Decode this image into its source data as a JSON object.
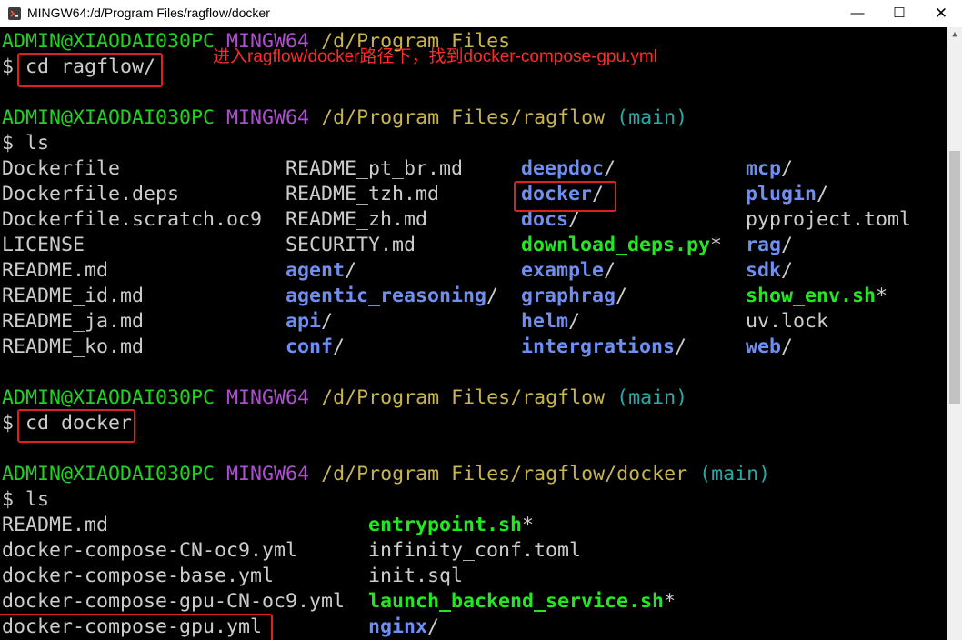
{
  "window": {
    "title": "MINGW64:/d/Program Files/ragflow/docker",
    "minimize": "—",
    "maximize": "☐",
    "close": "✕"
  },
  "annotation": "进入ragflow/docker路径下，找到docker-compose-gpu.yml",
  "colors": {
    "prompt_user": "#1fd41f",
    "mingw": "#b04cd4",
    "path": "#c8b44a",
    "branch": "#2aa8a8",
    "dir": "#6f8ff0",
    "exec": "#22e822",
    "highlight": "#e02020"
  },
  "prompts": [
    {
      "user": "ADMIN@XIAODAI030PC",
      "sys": "MINGW64",
      "path": "/d/Program Files",
      "branch": ""
    },
    {
      "user": "ADMIN@XIAODAI030PC",
      "sys": "MINGW64",
      "path": "/d/Program Files/ragflow",
      "branch": "(main)"
    },
    {
      "user": "ADMIN@XIAODAI030PC",
      "sys": "MINGW64",
      "path": "/d/Program Files/ragflow",
      "branch": "(main)"
    },
    {
      "user": "ADMIN@XIAODAI030PC",
      "sys": "MINGW64",
      "path": "/d/Program Files/ragflow/docker",
      "branch": "(main)"
    }
  ],
  "commands": [
    {
      "ps": "$ ",
      "cmd": "cd ragflow/"
    },
    {
      "ps": "$ ",
      "cmd": "ls"
    },
    {
      "ps": "$ ",
      "cmd": "cd docker"
    },
    {
      "ps": "$ ",
      "cmd": "ls"
    }
  ],
  "ls1": {
    "col1": [
      {
        "name": "Dockerfile",
        "suffix": ""
      },
      {
        "name": "Dockerfile.deps",
        "suffix": ""
      },
      {
        "name": "Dockerfile.scratch.oc9",
        "suffix": ""
      },
      {
        "name": "LICENSE",
        "suffix": ""
      },
      {
        "name": "README.md",
        "suffix": ""
      },
      {
        "name": "README_id.md",
        "suffix": ""
      },
      {
        "name": "README_ja.md",
        "suffix": ""
      },
      {
        "name": "README_ko.md",
        "suffix": ""
      }
    ],
    "col2": [
      {
        "name": "README_pt_br.md",
        "suffix": ""
      },
      {
        "name": "README_tzh.md",
        "suffix": ""
      },
      {
        "name": "README_zh.md",
        "suffix": ""
      },
      {
        "name": "SECURITY.md",
        "suffix": ""
      },
      {
        "name": "agent",
        "suffix": "/"
      },
      {
        "name": "agentic_reasoning",
        "suffix": "/"
      },
      {
        "name": "api",
        "suffix": "/"
      },
      {
        "name": "conf",
        "suffix": "/"
      }
    ],
    "col3": [
      {
        "name": "deepdoc",
        "suffix": "/"
      },
      {
        "name": "docker",
        "suffix": "/"
      },
      {
        "name": "docs",
        "suffix": "/"
      },
      {
        "name": "download_deps.py",
        "suffix": "*"
      },
      {
        "name": "example",
        "suffix": "/"
      },
      {
        "name": "graphrag",
        "suffix": "/"
      },
      {
        "name": "helm",
        "suffix": "/"
      },
      {
        "name": "intergrations",
        "suffix": "/"
      }
    ],
    "col4": [
      {
        "name": "mcp",
        "suffix": "/"
      },
      {
        "name": "plugin",
        "suffix": "/"
      },
      {
        "name": "pyproject.toml",
        "suffix": ""
      },
      {
        "name": "rag",
        "suffix": "/"
      },
      {
        "name": "sdk",
        "suffix": "/"
      },
      {
        "name": "show_env.sh",
        "suffix": "*"
      },
      {
        "name": "uv.lock",
        "suffix": ""
      },
      {
        "name": "web",
        "suffix": "/"
      }
    ]
  },
  "ls2": {
    "col1": [
      {
        "name": "README.md",
        "suffix": ""
      },
      {
        "name": "docker-compose-CN-oc9.yml",
        "suffix": ""
      },
      {
        "name": "docker-compose-base.yml",
        "suffix": ""
      },
      {
        "name": "docker-compose-gpu-CN-oc9.yml",
        "suffix": ""
      },
      {
        "name": "docker-compose-gpu.yml",
        "suffix": ""
      }
    ],
    "col2": [
      {
        "name": "entrypoint.sh",
        "suffix": "*"
      },
      {
        "name": "infinity_conf.toml",
        "suffix": ""
      },
      {
        "name": "init.sql",
        "suffix": ""
      },
      {
        "name": "launch_backend_service.sh",
        "suffix": "*"
      },
      {
        "name": "nginx",
        "suffix": "/"
      }
    ]
  }
}
